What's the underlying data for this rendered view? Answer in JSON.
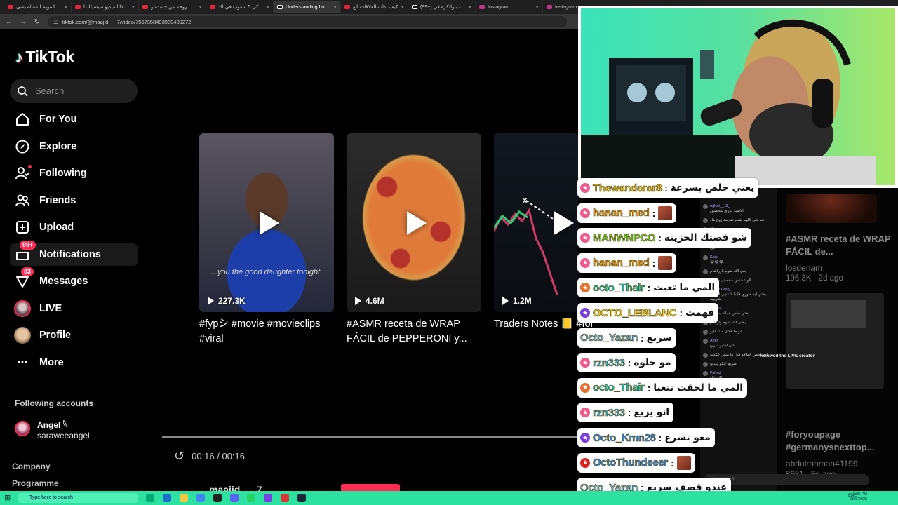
{
  "browser": {
    "tabs": [
      {
        "title": "هل التنويم المغناطيسي",
        "kind": "yt"
      },
      {
        "title": "هذا الفيديو سيشيلك ا..",
        "kind": "yt"
      },
      {
        "title": "خرجت روحه عن جسده و",
        "kind": "yt"
      },
      {
        "title": "أذكى 5 شعوب في الد..",
        "kind": "yt"
      },
      {
        "title": "Understanding Love or",
        "kind": "tt",
        "active": true
      },
      {
        "title": "كيف بدات العلاقات الع",
        "kind": "yt"
      },
      {
        "title": "(99+) الحب والكره في",
        "kind": "tt"
      },
      {
        "title": "Instagram",
        "kind": "ig"
      },
      {
        "title": "Instagram",
        "kind": "ig"
      }
    ],
    "url": "tiktok.com/@maajid___7/video/7557358493930409272"
  },
  "sidebar": {
    "logo": "TikTok",
    "search_placeholder": "Search",
    "items": [
      {
        "label": "For You"
      },
      {
        "label": "Explore"
      },
      {
        "label": "Following"
      },
      {
        "label": "Friends"
      },
      {
        "label": "Upload"
      },
      {
        "label": "Notifications",
        "badge": "99+"
      },
      {
        "label": "Messages",
        "badge": "83"
      },
      {
        "label": "LIVE"
      },
      {
        "label": "Profile"
      },
      {
        "label": "More"
      }
    ],
    "following_title": "Following accounts",
    "following_account": {
      "name": "Angel 𓆩",
      "handle": "saraweeangel"
    },
    "footer": [
      "Company",
      "Programme"
    ]
  },
  "videos": [
    {
      "views": "227.3K",
      "caption": "#fypシ #movie #movieclips #viral",
      "subtitle": "...you the good daughter tonight."
    },
    {
      "views": "4.6M",
      "caption": "#ASMR receta de WRAP FÁCIL de PEPPERONI y..."
    },
    {
      "views": "1.2M",
      "caption": "Traders Notes 📒 #forex #forextrading #crv"
    }
  ],
  "player": {
    "time": "00:16 / 00:16",
    "author": "maajid___7"
  },
  "right_column": {
    "items": [
      {
        "title": "#ASMR receta de WRAP FÁCIL de...",
        "user": "losdenam",
        "stats": "196.3K · 2d ago"
      },
      {
        "title": "#foryoupage #germanysnexttop...",
        "user": "abdulrahman41199",
        "stats": "8681 · 5d ago"
      }
    ]
  },
  "live_panel": {
    "rows": [
      {
        "user": "...",
        "text": "تشبهه"
      },
      {
        "user": "rojhat__18_",
        "text": "الاصبه دوري شخصين"
      },
      {
        "user": "",
        "text": "اعم شي اللهم تقدم تقديمة زوج هاد"
      },
      {
        "user": "Mohammed",
        "text": "جون سينا"
      },
      {
        "user": "zako",
        "text": "ابي"
      },
      {
        "user": "Kais",
        "text": "😂😂😂"
      },
      {
        "user": "",
        "text": "يخي الله تقوم بازراشام"
      },
      {
        "user": "",
        "text": "الو عشاش مخصنی سرعة"
      },
      {
        "user": "Glove Glory",
        "text": "يختي ايه ضوري قليبا لا تنتهي الكذب شريبية"
      },
      {
        "user": "Hades",
        "text": "يختي خلص صبانة بسرعة"
      },
      {
        "user": "",
        "text": "يختي الله تقوم وارشام"
      },
      {
        "user": "",
        "text": "انو ما هكال مننا عليو"
      },
      {
        "user": "Amir",
        "text": "كان لختير سريع"
      },
      {
        "user": "",
        "text": "انو تلخص العلاقة قبل ما تنتهي الكذبة"
      },
      {
        "user": "",
        "text": "ضربها ليكو سريع"
      },
      {
        "user": "Fahad",
        "text": "الانتشاء"
      },
      {
        "user": "KURDISTAN 366",
        "text": "joined"
      }
    ],
    "followed_note": "followed the LIVE creator",
    "add_comment": "Add comment"
  },
  "overlay_chat": [
    {
      "user": "Thewanderer8",
      "text": "يعني خلص بسرعة",
      "color": "#e6c229",
      "badge": "pink"
    },
    {
      "user": "hanan_med",
      "text": "",
      "color": "#f0a020",
      "badge": "pink",
      "emote": true
    },
    {
      "user": "MANWNPCO",
      "text": "شو قصتك الحزينة",
      "color": "#7bd13a",
      "badge": "pink"
    },
    {
      "user": "hanan_med",
      "text": "",
      "color": "#f0a020",
      "badge": "pink",
      "emote": true
    },
    {
      "user": "octo_Thair",
      "text": "المي ما تعبت",
      "color": "#28c9b4",
      "badge": "orange"
    },
    {
      "user": "OCTO_LEBLANC",
      "text": "فهمت",
      "color": "#f2d033",
      "badge": "purple"
    },
    {
      "user": "Octo_Yazan",
      "text": "سريع",
      "color": "#6fb3d8",
      "badge": "none"
    },
    {
      "user": "rzn333",
      "text": "مو حلوه",
      "color": "#3fb6d8",
      "badge": "pink"
    },
    {
      "user": "octo_Thair",
      "text": "المي ما لحقت تتعبا",
      "color": "#28c9b4",
      "badge": "orange"
    },
    {
      "user": "rzn333",
      "text": "انو يربع",
      "color": "#3fb6d8",
      "badge": "pink"
    },
    {
      "user": "Octo_Kmn28",
      "text": "معو تسرع",
      "color": "#3a8fe8",
      "badge": "purple"
    },
    {
      "user": "OctoThundeeer",
      "text": "",
      "color": "#3a8fe8",
      "badge": "red",
      "emote": true
    },
    {
      "user": "Octo_Yazan",
      "text": "عندو قصف سريع",
      "color": "#6fb3d8",
      "badge": "none"
    }
  ],
  "taskbar": {
    "search_placeholder": "Type here to search",
    "clock": "11:29 PM\n10/6/2025",
    "lang": "ENG"
  }
}
